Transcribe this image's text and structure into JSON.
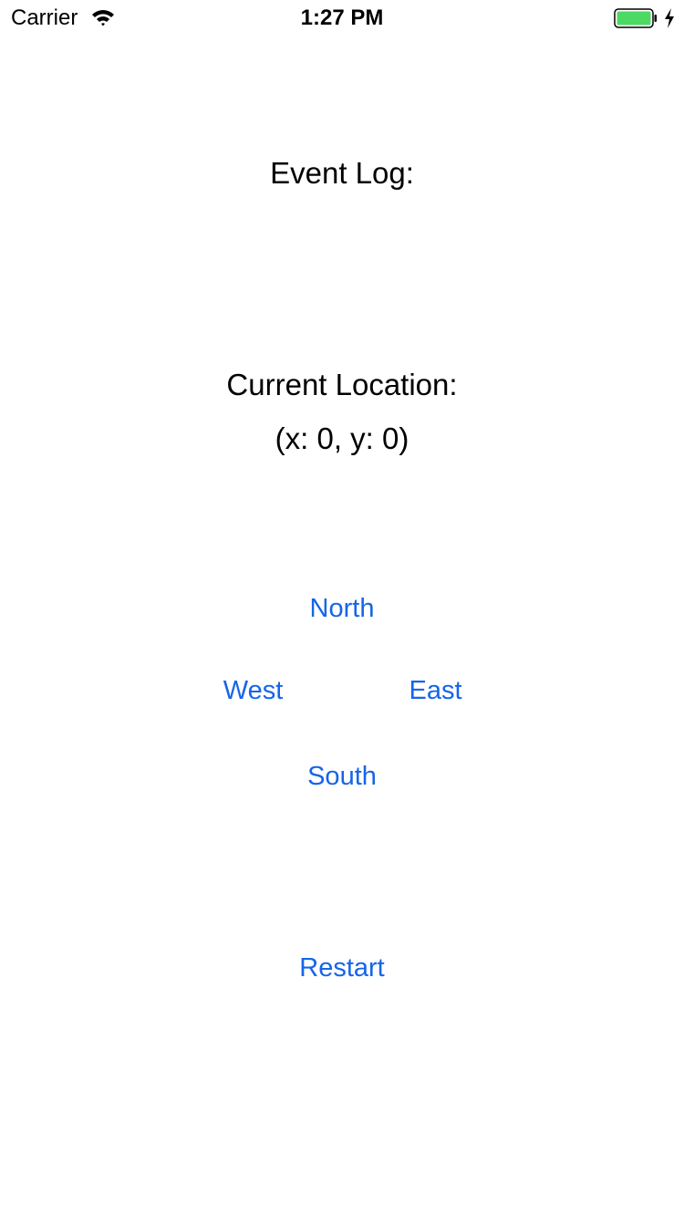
{
  "status_bar": {
    "carrier": "Carrier",
    "time": "1:27 PM",
    "wifi_icon": "wifi-icon",
    "battery_icon": "battery-icon",
    "charging_icon": "charging-bolt-icon",
    "battery_level": 1.0,
    "battery_color": "#4cd964"
  },
  "event_log": {
    "label": "Event Log:"
  },
  "location": {
    "title": "Current Location:",
    "value": "(x: 0, y: 0)"
  },
  "controls": {
    "north": "North",
    "west": "West",
    "east": "East",
    "south": "South",
    "restart": "Restart"
  },
  "colors": {
    "accent": "#1565e8",
    "text": "#000000",
    "background": "#ffffff"
  }
}
